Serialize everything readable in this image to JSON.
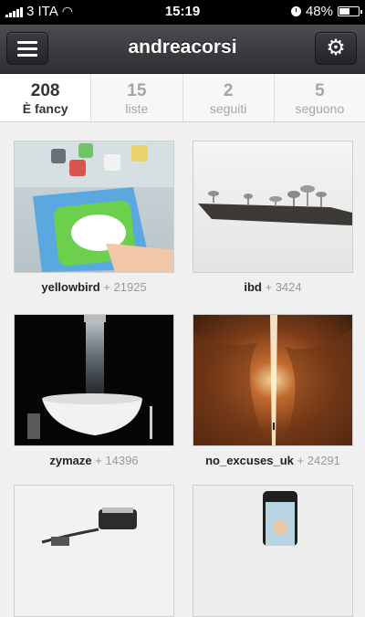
{
  "status_bar": {
    "carrier": "3 ITA",
    "time": "15:19",
    "battery": "48%",
    "battery_level": 0.48
  },
  "nav": {
    "title": "andreacorsi",
    "menu_icon": "hamburger-icon",
    "settings_icon": "gear-icon"
  },
  "stats": [
    {
      "value": "208",
      "label": "È fancy"
    },
    {
      "value": "15",
      "label": "liste"
    },
    {
      "value": "2",
      "label": "seguiti"
    },
    {
      "value": "5",
      "label": "seguono"
    }
  ],
  "items": [
    {
      "user": "yellowbird",
      "count": "+ 21925"
    },
    {
      "user": "ibd",
      "count": "+ 3424"
    },
    {
      "user": "zymaze",
      "count": "+ 14396"
    },
    {
      "user": "no_excuses_uk",
      "count": "+ 24291"
    }
  ],
  "colors": {
    "navbar": "#3a3c40",
    "background": "#f0f0f0",
    "username": "#222222",
    "count": "#999999"
  }
}
